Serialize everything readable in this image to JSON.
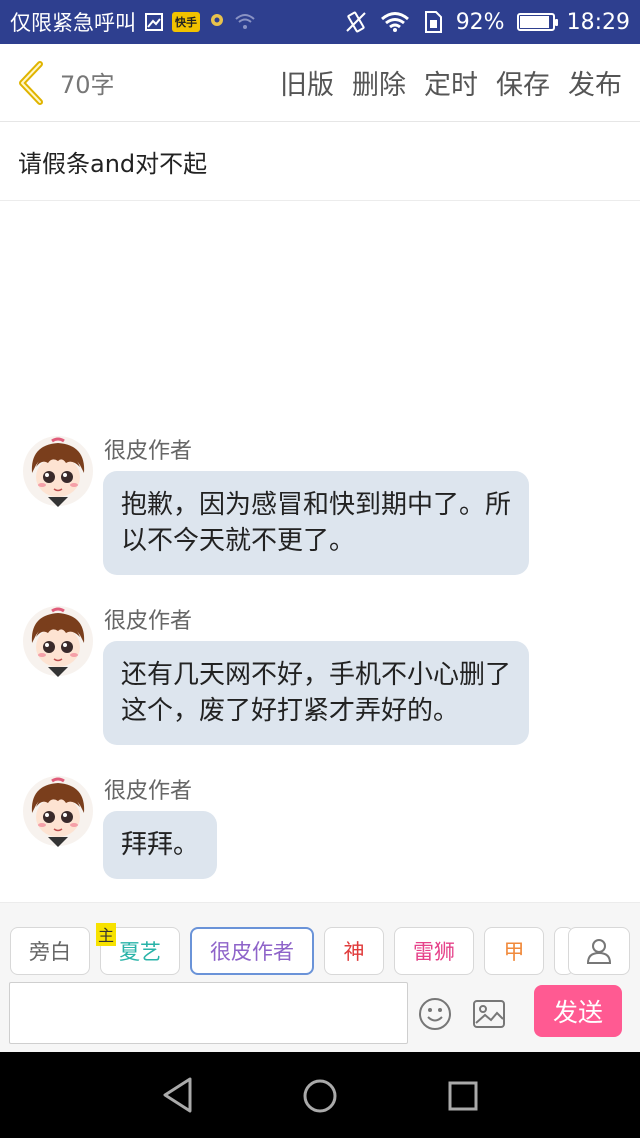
{
  "status_bar": {
    "carrier": "仅限紧急呼叫",
    "battery_percent": "92%",
    "battery_level": 0.92,
    "time": "18:29",
    "icons": [
      "image-notification-icon",
      "kuaishou-app-icon",
      "location-icon",
      "wifi-weak-icon",
      "vibrate-icon",
      "wifi-icon",
      "sim-icon",
      "battery-icon"
    ]
  },
  "toolbar": {
    "word_count": "70字",
    "actions": [
      "旧版",
      "删除",
      "定时",
      "保存",
      "发布"
    ],
    "app_badge": "快手"
  },
  "document": {
    "title": "请假条and对不起"
  },
  "messages": [
    {
      "author": "很皮作者",
      "lines": [
        "抱歉，因为感冒和快到期中了。所",
        "以不今天就不更了。"
      ]
    },
    {
      "author": "很皮作者",
      "lines": [
        "还有几天网不好，手机不小心删了",
        "这个，废了好打紧才弄好的。"
      ]
    },
    {
      "author": "很皮作者",
      "lines": [
        "拜拜。"
      ]
    }
  ],
  "characters": [
    {
      "name": "旁白",
      "color": "#666666"
    },
    {
      "name": "夏艺",
      "color": "#29b3a8",
      "tag": "主"
    },
    {
      "name": "很皮作者",
      "color": "#8e63c9",
      "selected": true
    },
    {
      "name": "神",
      "color": "#e03b3b"
    },
    {
      "name": "雷狮",
      "color": "#e6428a"
    },
    {
      "name": "甲",
      "color": "#f08a3c"
    }
  ],
  "input": {
    "value": "",
    "send_label": "发送"
  },
  "colors": {
    "status_bar": "#2e3f8f",
    "bubble": "#dde5ee",
    "send_button": "#ff5a92",
    "back_arrow": "#e0b400"
  }
}
